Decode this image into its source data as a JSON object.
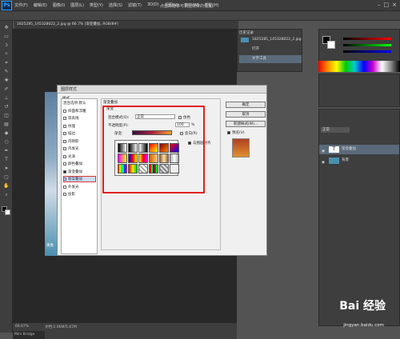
{
  "app": {
    "logo": "Ps",
    "title": "点击并拖移可调整效果的位置。",
    "menus": [
      "文件(F)",
      "编辑(E)",
      "图像(I)",
      "图层(L)",
      "类型(Y)",
      "选择(S)",
      "滤镜(T)",
      "3D(D)",
      "视图(V)",
      "窗口(W)",
      "帮助(H)"
    ],
    "window_controls": [
      "–",
      "□",
      "×"
    ]
  },
  "document": {
    "tab": "1825285_145328022_2.jpg @ 66.7% (渐变叠加, RGB/8#)",
    "photo_caption": "黄昏",
    "zoom": "66.67%",
    "doc_info": "文档:2.06M/5.67M",
    "bridge": "Mini Bridge"
  },
  "history": {
    "title": "历史记录",
    "items": [
      "1825285_145328022_2.jpg",
      "打开",
      "文字工具"
    ]
  },
  "layers": {
    "mode": "正常",
    "items": [
      "渐变叠加",
      "背景"
    ]
  },
  "dialog": {
    "title": "图层样式",
    "list_header": "样式",
    "list": [
      {
        "label": "混合选项:默认",
        "check": false,
        "hascb": false
      },
      {
        "label": "斜面和浮雕",
        "check": false,
        "hascb": true
      },
      {
        "label": "等高线",
        "check": false,
        "hascb": true
      },
      {
        "label": "纹理",
        "check": false,
        "hascb": true
      },
      {
        "label": "描边",
        "check": false,
        "hascb": true
      },
      {
        "label": "内阴影",
        "check": false,
        "hascb": true
      },
      {
        "label": "内发光",
        "check": false,
        "hascb": true
      },
      {
        "label": "光泽",
        "check": false,
        "hascb": true
      },
      {
        "label": "颜色叠加",
        "check": false,
        "hascb": true
      },
      {
        "label": "渐变叠加",
        "check": true,
        "hascb": true
      },
      {
        "label": "图案叠加",
        "check": false,
        "hascb": true
      },
      {
        "label": "外发光",
        "check": false,
        "hascb": true
      },
      {
        "label": "投影",
        "check": false,
        "hascb": true
      }
    ],
    "section_title": "渐变叠加",
    "group_title": "渐变",
    "blend_label": "混合模式(O):",
    "blend_value": "正常",
    "dither": "仿色",
    "opacity_label": "不透明度(P):",
    "opacity_value": "100",
    "opacity_unit": "%",
    "gradient_label": "渐变:",
    "reverse": "反向(R)",
    "align": "与图层对齐",
    "btn_ok": "确定",
    "btn_cancel": "取消",
    "btn_new": "新建样式(W)...",
    "preview_label": "预览(V)"
  },
  "watermark": {
    "text": "Bai 经验",
    "url": "jingyan.baidu.com"
  }
}
